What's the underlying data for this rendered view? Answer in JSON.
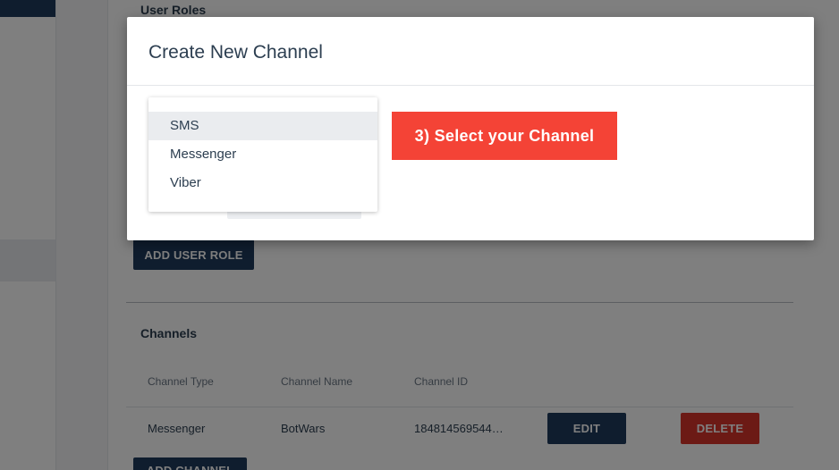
{
  "background": {
    "user_roles_title": "User Roles",
    "add_user_role_label": "ADD USER ROLE",
    "channels": {
      "title": "Channels",
      "columns": [
        "Channel Type",
        "Channel Name",
        "Channel ID"
      ],
      "rows": [
        {
          "type": "Messenger",
          "name": "BotWars",
          "id": "184814569544…",
          "edit_label": "EDIT",
          "delete_label": "DELETE"
        }
      ],
      "add_channel_label": "ADD CHANNEL"
    }
  },
  "modal": {
    "title": "Create New Channel",
    "dropdown": {
      "options": [
        "SMS",
        "Messenger",
        "Viber"
      ],
      "highlighted": "SMS"
    },
    "callout": "3) Select your Channel"
  },
  "colors": {
    "navy": "#1f3a5c",
    "danger": "#d9342b",
    "callout": "#f44336"
  }
}
